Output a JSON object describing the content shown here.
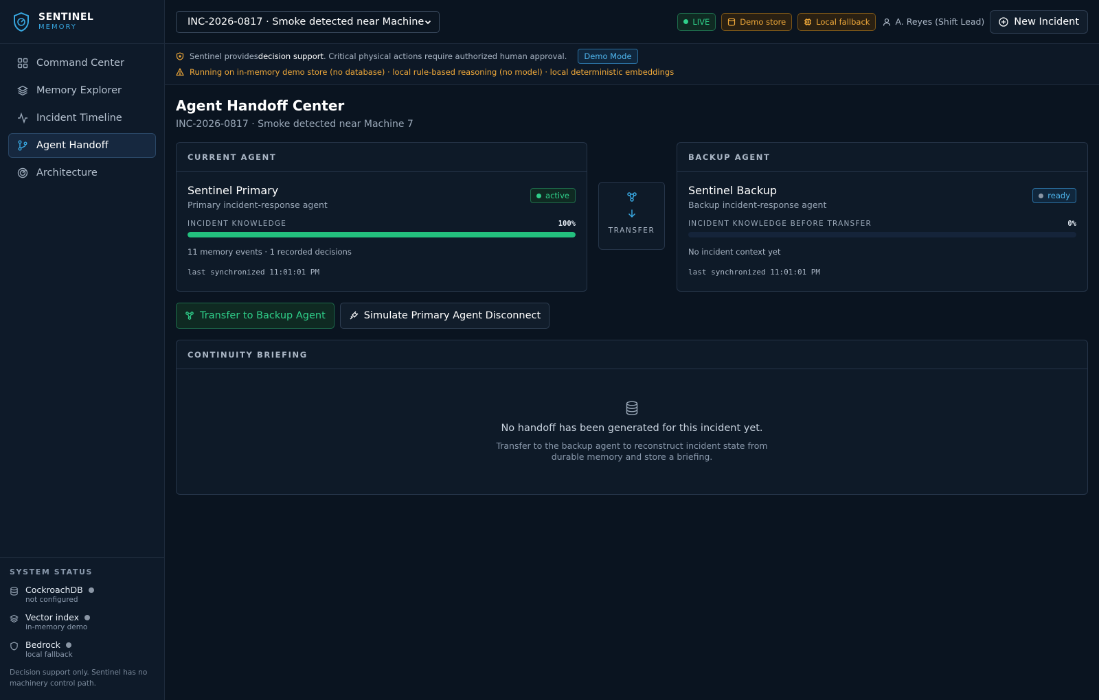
{
  "brand": {
    "title": "SENTINEL",
    "subtitle": "MEMORY"
  },
  "nav": [
    {
      "label": "Command Center",
      "icon": "grid-icon"
    },
    {
      "label": "Memory Explorer",
      "icon": "layers-icon"
    },
    {
      "label": "Incident Timeline",
      "icon": "activity-icon"
    },
    {
      "label": "Agent Handoff",
      "icon": "git-branch-icon",
      "active": true
    },
    {
      "label": "Architecture",
      "icon": "radar-icon"
    }
  ],
  "system": {
    "heading": "SYSTEM STATUS",
    "items": [
      {
        "name": "CockroachDB",
        "state": "not configured"
      },
      {
        "name": "Vector index",
        "state": "in-memory demo"
      },
      {
        "name": "Bedrock",
        "state": "local fallback"
      }
    ],
    "note": "Decision support only. Sentinel has no machinery control path."
  },
  "topbar": {
    "incident_select": "INC-2026-0817 · Smoke detected near Machine",
    "badges": {
      "live": "LIVE",
      "demo_store": "Demo store",
      "local_fallback": "Local fallback"
    },
    "user": "A. Reyes (Shift Lead)",
    "new_incident": "New Incident"
  },
  "notice": {
    "pre": "Sentinel provides ",
    "bold": "decision support",
    "post": ". Critical physical actions require authorized human approval.",
    "demo_mode": "Demo Mode",
    "warning": "Running on in-memory demo store (no database) · local rule-based reasoning (no model) · local deterministic embeddings"
  },
  "page": {
    "title": "Agent Handoff Center",
    "subtitle": "INC-2026-0817 · Smoke detected near Machine 7"
  },
  "current": {
    "heading": "CURRENT AGENT",
    "name": "Sentinel Primary",
    "desc": "Primary incident-response agent",
    "status": "active",
    "knowledge_label": "INCIDENT KNOWLEDGE",
    "knowledge_pct": "100%",
    "knowledge_value": 100,
    "events": "11 memory events · 1 recorded decisions",
    "sync": "last synchronized 11:01:01 PM"
  },
  "transfer": {
    "label": "TRANSFER"
  },
  "backup": {
    "heading": "BACKUP AGENT",
    "name": "Sentinel Backup",
    "desc": "Backup incident-response agent",
    "status": "ready",
    "knowledge_label": "INCIDENT KNOWLEDGE BEFORE TRANSFER",
    "knowledge_pct": "0%",
    "knowledge_value": 0,
    "events": "No incident context yet",
    "sync": "last synchronized 11:01:01 PM"
  },
  "actions": {
    "transfer": "Transfer to Backup Agent",
    "simulate": "Simulate Primary Agent Disconnect"
  },
  "briefing": {
    "heading": "CONTINUITY BRIEFING",
    "empty_title": "No handoff has been generated for this incident yet.",
    "empty_text": "Transfer to the backup agent to reconstruct incident state from durable memory and store a briefing."
  },
  "colors": {
    "accent": "#38a7e0",
    "success": "#23c07e",
    "warning": "#f0a93a",
    "background": "#0a1420"
  }
}
